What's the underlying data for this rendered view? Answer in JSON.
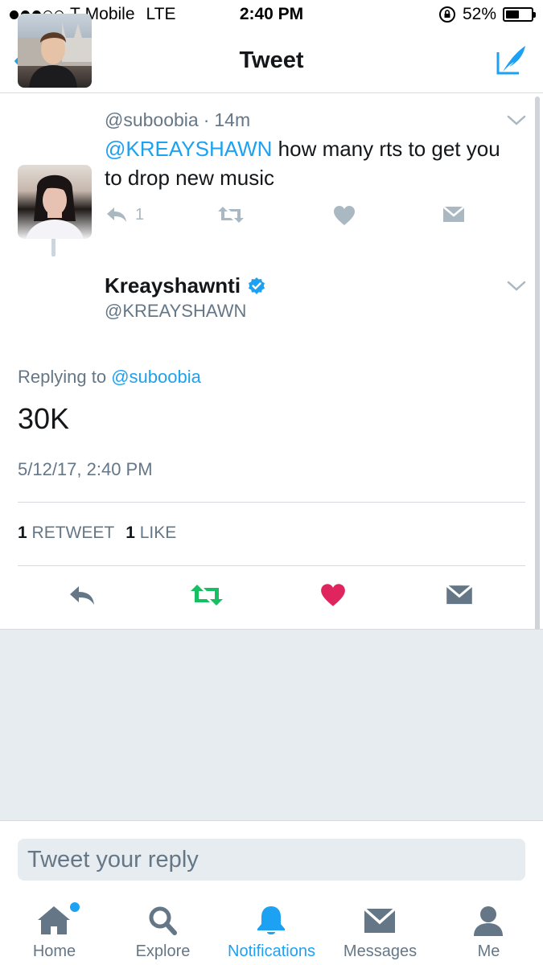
{
  "status_bar": {
    "carrier": "T-Mobile",
    "network": "LTE",
    "time": "2:40 PM",
    "battery_percent": "52%",
    "battery_level": 0.52,
    "signal_bars": 3
  },
  "nav": {
    "title": "Tweet",
    "back_icon": "chevron-left-icon",
    "compose_icon": "compose-quill-icon"
  },
  "parent_tweet": {
    "handle": "@suboobia",
    "separator": "·",
    "age": "14m",
    "mention": "@KREAYSHAWN",
    "text": " how many rts to get you to drop new music",
    "reply_count": "1"
  },
  "main_tweet": {
    "name": "Kreayshawnti",
    "handle": "@KREAYSHAWN",
    "replying_prefix": "Replying to",
    "replying_to": "@suboobia",
    "text": "30K",
    "timestamp": "5/12/17, 2:40 PM",
    "retweet_count": "1",
    "retweet_label": "RETWEET",
    "like_count": "1",
    "like_label": "LIKE"
  },
  "reply": {
    "placeholder": "Tweet your reply"
  },
  "tabs": [
    {
      "label": "Home",
      "icon": "home-icon"
    },
    {
      "label": "Explore",
      "icon": "search-icon"
    },
    {
      "label": "Notifications",
      "icon": "bell-icon"
    },
    {
      "label": "Messages",
      "icon": "envelope-icon"
    },
    {
      "label": "Me",
      "icon": "person-icon"
    }
  ],
  "colors": {
    "accent": "#1da1f2",
    "retweet_green": "#17bf63",
    "like_red": "#e0245e",
    "muted": "#657786",
    "action_gray": "#aab8c2"
  }
}
